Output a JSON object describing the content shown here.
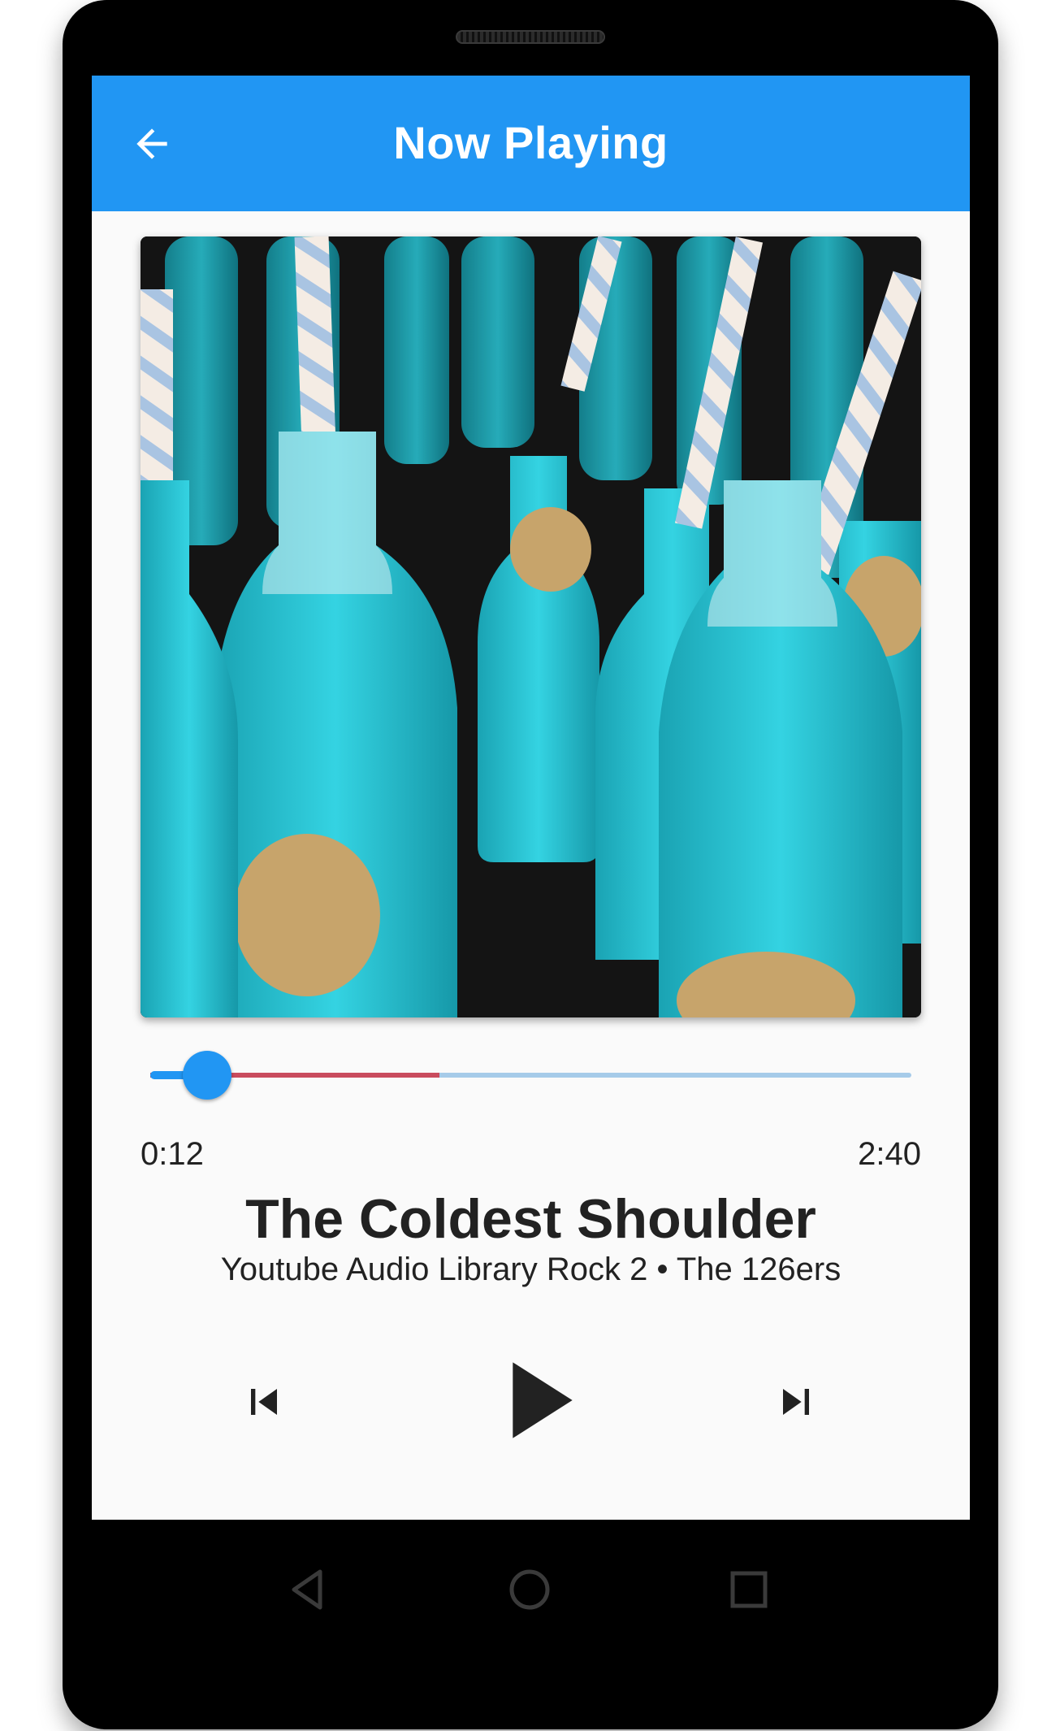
{
  "app_bar": {
    "title": "Now Playing",
    "back_icon": "arrow-back-icon",
    "color": "#2196f3"
  },
  "album_art": {
    "icon": "album-art-image"
  },
  "player": {
    "elapsed": "0:12",
    "duration": "2:40",
    "progress": 0.075,
    "buffered": 0.38,
    "accent_color": "#2196f3",
    "buffer_color": "#c94c5e"
  },
  "track": {
    "title": "The Coldest Shoulder",
    "subtitle": "Youtube Audio Library Rock 2 • The 126ers"
  },
  "controls": {
    "previous_icon": "skip-previous-icon",
    "play_icon": "play-icon",
    "next_icon": "skip-next-icon"
  },
  "system_nav": {
    "back_icon": "nav-back-icon",
    "home_icon": "nav-home-icon",
    "recents_icon": "nav-recents-icon"
  }
}
